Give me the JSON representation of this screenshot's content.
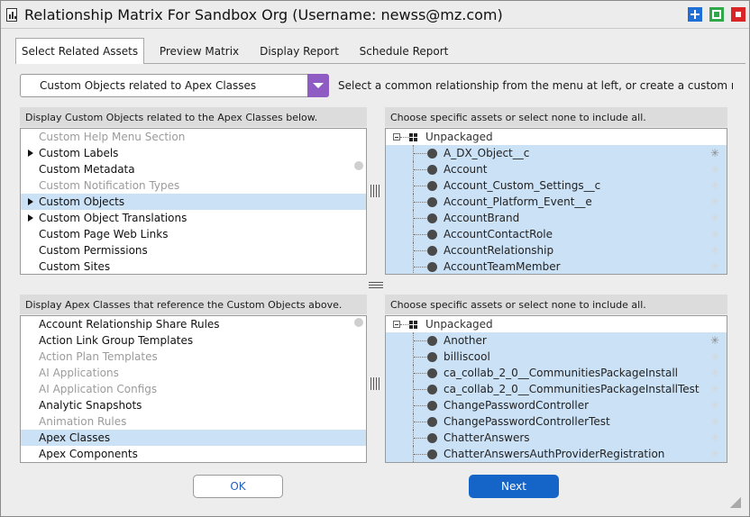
{
  "window": {
    "title": "Relationship Matrix For Sandbox Org (Username: newss@mz.com)",
    "controls": {
      "add": "add-icon",
      "maximize": "maximize-icon",
      "close": "close-icon"
    },
    "control_colors": {
      "add": "#1f6fd6",
      "maximize": "#2fa84a",
      "close": "#d92525"
    }
  },
  "tabs": [
    {
      "label": "Select Related Assets",
      "active": true
    },
    {
      "label": "Preview Matrix",
      "active": false
    },
    {
      "label": "Display Report",
      "active": false
    },
    {
      "label": "Schedule Report",
      "active": false
    }
  ],
  "relationship": {
    "selected": "Custom Objects related to Apex Classes",
    "hint": "Select a common relationship from the menu at left, or create a custom relati",
    "accent_color": "#8e5cc2"
  },
  "top_left": {
    "header": "Display Custom Objects related to the Apex Classes below.",
    "items": [
      {
        "label": "Custom Help Menu Section",
        "dim": true,
        "expandable": false,
        "selected": false
      },
      {
        "label": "Custom Labels",
        "dim": false,
        "expandable": true,
        "selected": false
      },
      {
        "label": "Custom Metadata",
        "dim": false,
        "expandable": false,
        "selected": false
      },
      {
        "label": "Custom Notification Types",
        "dim": true,
        "expandable": false,
        "selected": false
      },
      {
        "label": "Custom Objects",
        "dim": false,
        "expandable": true,
        "selected": true
      },
      {
        "label": "Custom Object Translations",
        "dim": false,
        "expandable": true,
        "selected": false
      },
      {
        "label": "Custom Page Web Links",
        "dim": false,
        "expandable": false,
        "selected": false
      },
      {
        "label": "Custom Permissions",
        "dim": false,
        "expandable": false,
        "selected": false
      },
      {
        "label": "Custom Sites",
        "dim": false,
        "expandable": false,
        "selected": false
      }
    ]
  },
  "top_right": {
    "header": "Choose specific assets or select none to include all.",
    "root": "Unpackaged",
    "items": [
      "A_DX_Object__c",
      "Account",
      "Account_Custom_Settings__c",
      "Account_Platform_Event__e",
      "AccountBrand",
      "AccountContactRole",
      "AccountRelationship",
      "AccountTeamMember"
    ]
  },
  "bottom_left": {
    "header": "Display Apex Classes that reference the Custom Objects above.",
    "items": [
      {
        "label": "Account Relationship Share Rules",
        "dim": false,
        "selected": false
      },
      {
        "label": "Action Link Group Templates",
        "dim": false,
        "selected": false
      },
      {
        "label": "Action Plan Templates",
        "dim": true,
        "selected": false
      },
      {
        "label": "AI Applications",
        "dim": true,
        "selected": false
      },
      {
        "label": "AI Application Configs",
        "dim": true,
        "selected": false
      },
      {
        "label": "Analytic Snapshots",
        "dim": false,
        "selected": false
      },
      {
        "label": "Animation Rules",
        "dim": true,
        "selected": false
      },
      {
        "label": "Apex Classes",
        "dim": false,
        "selected": true
      },
      {
        "label": "Apex Components",
        "dim": false,
        "selected": false
      }
    ]
  },
  "bottom_right": {
    "header": "Choose specific assets or select none to include all.",
    "root": "Unpackaged",
    "items": [
      "Another",
      "billiscool",
      "ca_collab_2_0__CommunitiesPackageInstall",
      "ca_collab_2_0__CommunitiesPackageInstallTest",
      "ChangePasswordController",
      "ChangePasswordControllerTest",
      "ChatterAnswers",
      "ChatterAnswersAuthProviderRegistration"
    ]
  },
  "buttons": {
    "ok": "OK",
    "next": "Next"
  },
  "colors": {
    "selection": "#cbe1f6",
    "primary": "#1565c8"
  }
}
